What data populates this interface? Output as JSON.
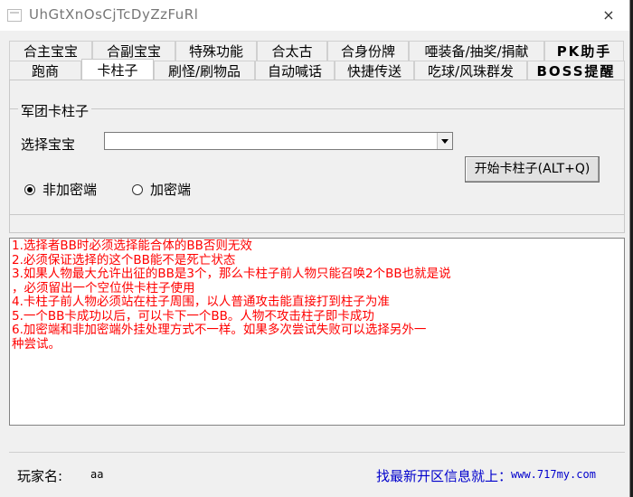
{
  "window": {
    "title": "UhGtXnOsCjTcDyZzFuRl",
    "close_icon": "×"
  },
  "tabs_row1": [
    "合主宝宝",
    "合副宝宝",
    "特殊功能",
    "合太古",
    "合身份牌",
    "唖装备/抽奖/捐献",
    "PK助手"
  ],
  "tabs_row2": [
    "跑商",
    "卡柱子",
    "刷怪/刷物品",
    "自动喊话",
    "快捷传送",
    "吃球/风珠群发",
    "BOSS提醒"
  ],
  "active_tab": "卡柱子",
  "group": {
    "title": "军团卡柱子",
    "select_label": "选择宝宝",
    "select_value": "",
    "start_button": "开始卡柱子(ALT+Q)",
    "radio_plain": "非加密端",
    "radio_encrypted": "加密端",
    "radio_selected": "非加密端"
  },
  "notes": [
    "1.选择者BB时必须选择能合体的BB否则无效",
    "2.必须保证选择的这个BB能不是死亡状态",
    "3.如果人物最大允许出征的BB是3个，那么卡柱子前人物只能召唤2个BB也就是说",
    "，必须留出一个空位供卡柱子使用",
    "4.卡柱子前人物必须站在柱子周围，以人普通攻击能直接打到柱子为准",
    "5.一个BB卡成功以后，可以卡下一个BB。人物不攻击柱子即卡成功",
    "6.加密端和非加密端外挂处理方式不一样。如果多次尝试失败可以选择另外一",
    "种尝试。"
  ],
  "footer": {
    "player_label": "玩家名:",
    "player_name": "aa",
    "link_label": "找最新开区信息就上：",
    "link_url": "www.717my.com"
  }
}
